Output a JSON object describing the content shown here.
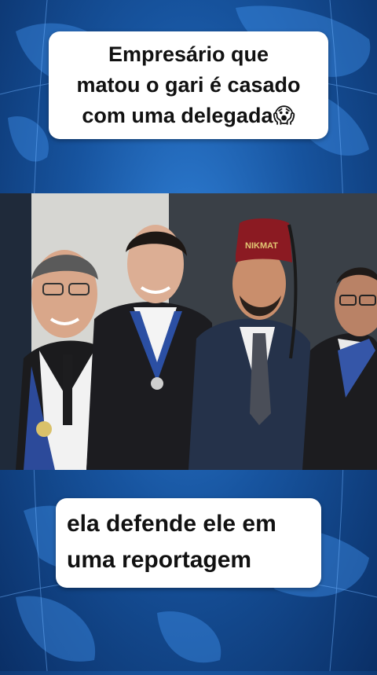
{
  "captions": {
    "top_line1": "Empresário que",
    "top_line2": "matou o gari é casado",
    "top_line3": "com uma delegada😱",
    "bottom_line1": "ela defende ele em",
    "bottom_line2": "uma reportagem"
  },
  "photo": {
    "fez_text": "NIKMAT",
    "subject": "four men in suits, one wearing a red fez"
  },
  "colors": {
    "background": "#17549f",
    "caption_bg": "#ffffff",
    "caption_text": "#111111",
    "fez": "#8b1a22"
  }
}
